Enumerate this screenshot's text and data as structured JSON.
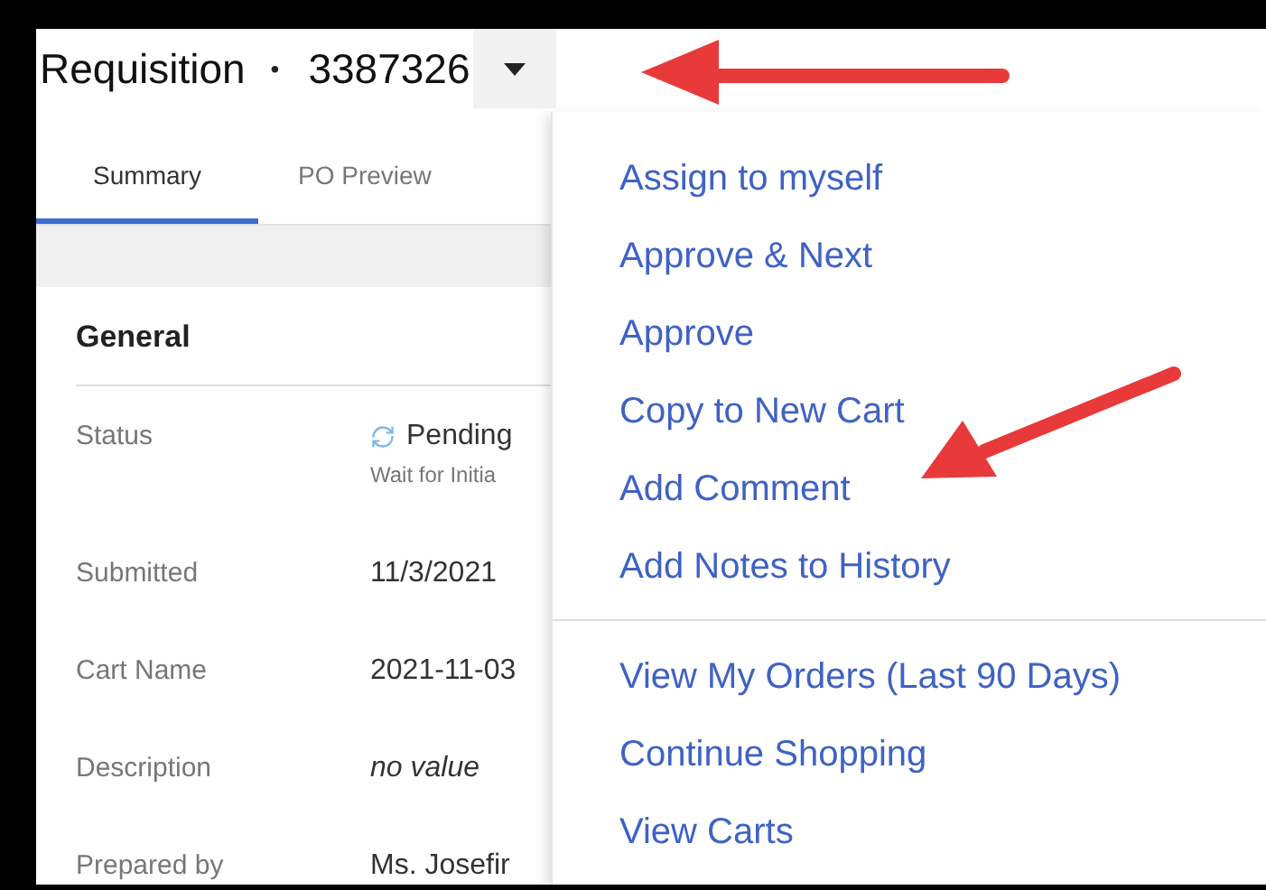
{
  "header": {
    "title": "Requisition",
    "separator": "•",
    "number": "3387326"
  },
  "tabs": [
    {
      "label": "Summary",
      "selected": true
    },
    {
      "label": "PO Preview",
      "selected": false
    }
  ],
  "general": {
    "heading": "General",
    "fields": [
      {
        "label": "Status",
        "value": "Pending",
        "note": "Wait for Initia",
        "kind": "status"
      },
      {
        "label": "Submitted",
        "value": "11/3/2021",
        "kind": "text"
      },
      {
        "label": "Cart Name",
        "value": "2021-11-03",
        "kind": "text"
      },
      {
        "label": "Description",
        "value": "no value",
        "kind": "empty"
      },
      {
        "label": "Prepared by",
        "value": "Ms. Josefir",
        "kind": "text"
      }
    ]
  },
  "menu": {
    "groups": [
      [
        "Assign to myself",
        "Approve & Next",
        "Approve",
        "Copy to New Cart",
        "Add Comment",
        "Add Notes to History"
      ],
      [
        "View My Orders (Last 90 Days)",
        "Continue Shopping",
        "View Carts"
      ]
    ]
  }
}
